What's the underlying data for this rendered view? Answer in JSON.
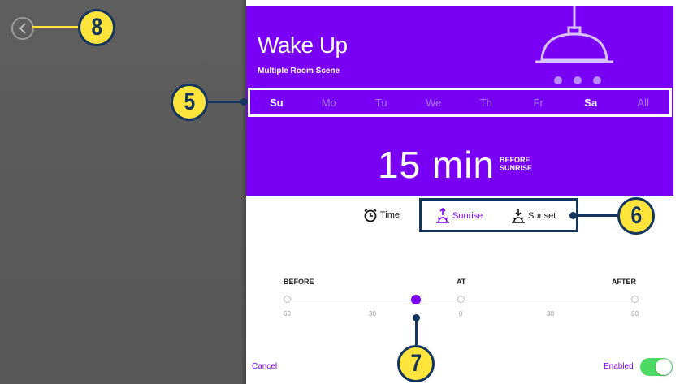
{
  "scene": {
    "title": "Wake Up",
    "subtitle": "Multiple Room Scene",
    "icon": "ceiling-lamp-icon"
  },
  "days": [
    {
      "label": "Su",
      "selected": true
    },
    {
      "label": "Mo",
      "selected": false
    },
    {
      "label": "Tu",
      "selected": false
    },
    {
      "label": "We",
      "selected": false
    },
    {
      "label": "Th",
      "selected": false
    },
    {
      "label": "Fr",
      "selected": false
    },
    {
      "label": "Sa",
      "selected": true
    },
    {
      "label": "All",
      "selected": false
    }
  ],
  "offset": {
    "value": "15 min",
    "relation_line1": "BEFORE",
    "relation_line2": "SUNRISE"
  },
  "modes": [
    {
      "label": "Time",
      "icon": "alarm-clock-icon",
      "selected": false
    },
    {
      "label": "Sunrise",
      "icon": "sunrise-icon",
      "selected": true
    },
    {
      "label": "Sunset",
      "icon": "sunset-icon",
      "selected": false
    }
  ],
  "slider": {
    "label_before": "BEFORE",
    "label_at": "AT",
    "label_after": "AFTER",
    "ticks": [
      "60",
      "30",
      "0",
      "30",
      "60"
    ],
    "value_minutes": -15
  },
  "footer": {
    "cancel_label": "Cancel",
    "enabled_label": "Enabled",
    "enabled": true
  },
  "callouts": [
    "8",
    "5",
    "6",
    "7"
  ],
  "colors": {
    "accent": "#7a00f5",
    "callout_fill": "#ffe43c",
    "callout_outline": "#14365e",
    "toggle_on": "#4cd964"
  }
}
